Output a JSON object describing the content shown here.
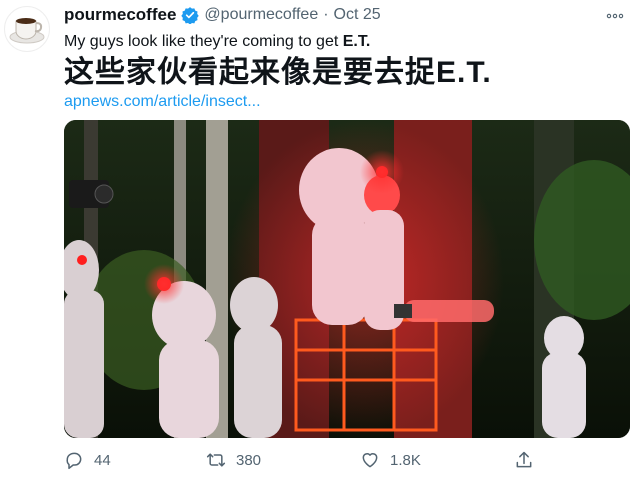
{
  "tweet": {
    "display_name": "pourmecoffee",
    "handle": "@pourmecoffee",
    "separator": "·",
    "date": "Oct 25",
    "caption_main": "My guys look like they're coming to get ",
    "caption_bold": "E.T.",
    "chinese_text": "这些家伙看起来像是要去捉E.T.",
    "link": "apnews.com/article/insect..."
  },
  "actions": {
    "replies": "44",
    "retweets": "380",
    "likes": "1.8K"
  },
  "icons": {
    "avatar": "coffee-cup-avatar",
    "verified": "verified-badge-icon",
    "more": "more-options-icon",
    "reply": "reply-icon",
    "retweet": "retweet-icon",
    "like": "heart-icon",
    "share": "share-icon"
  },
  "colors": {
    "link": "#1d9bf0",
    "muted": "#536471",
    "verified": "#1d9bf0",
    "suit_light": "#ff2b2b"
  }
}
